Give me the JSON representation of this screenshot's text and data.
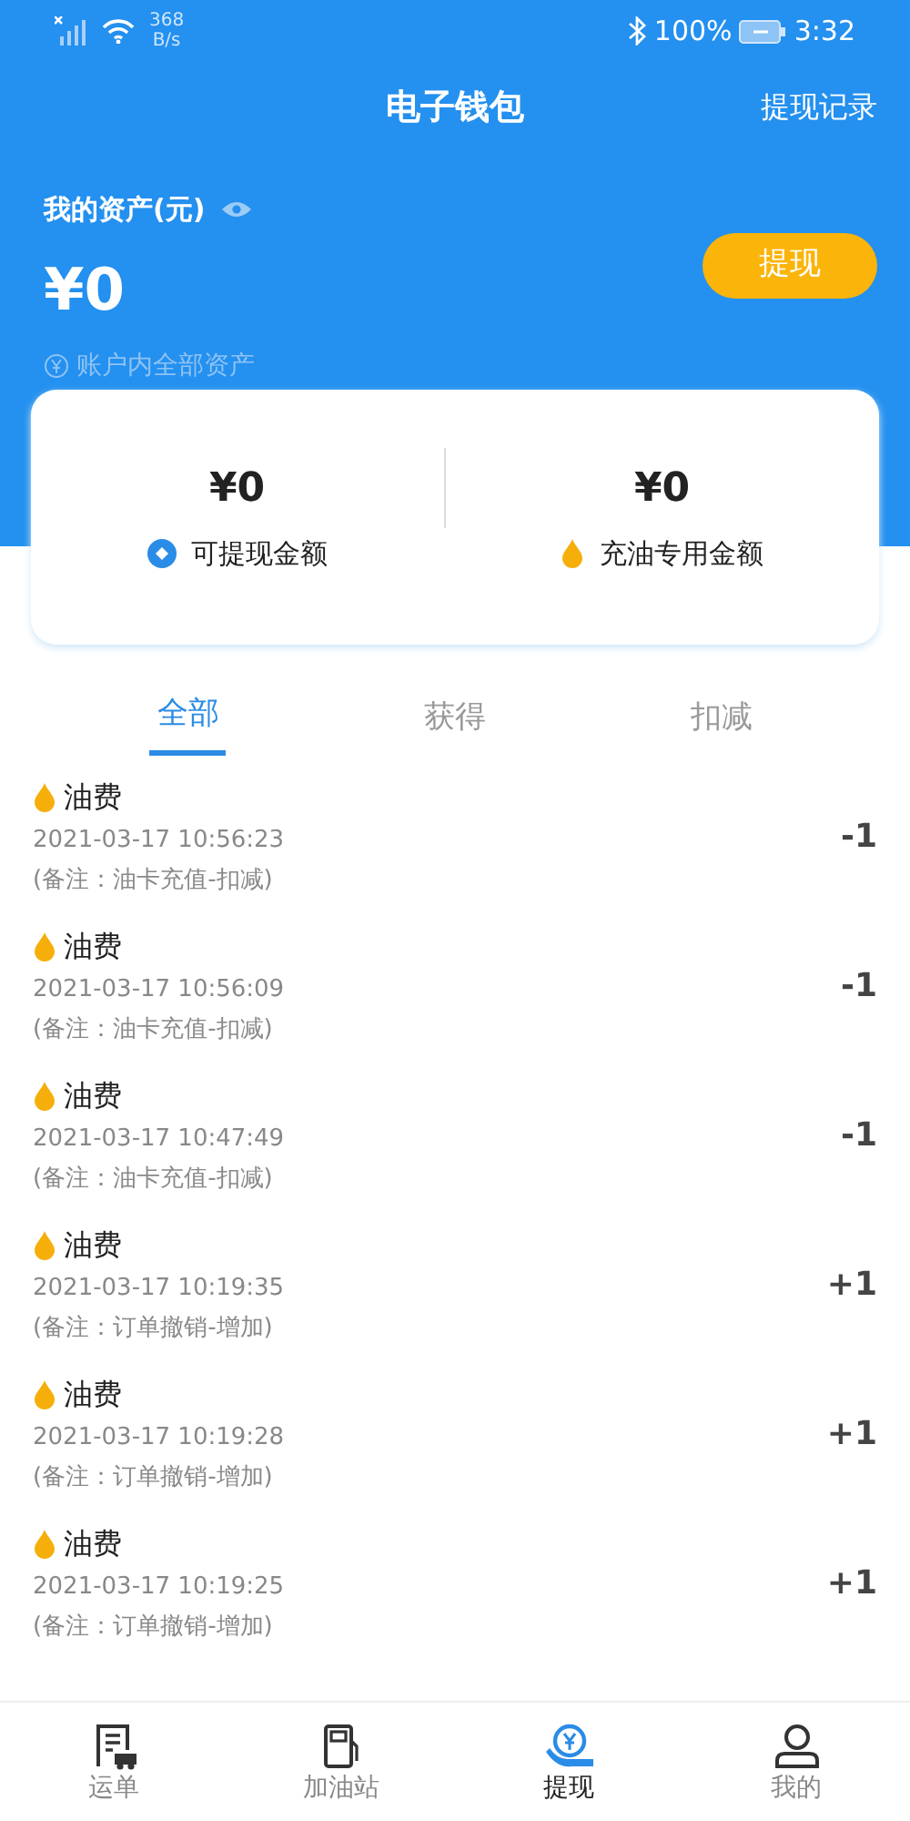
{
  "status_bar": {
    "speed": "368",
    "speed_unit": "B/s",
    "battery": "100%",
    "time": "3:32"
  },
  "header": {
    "title": "电子钱包",
    "action": "提现记录"
  },
  "assets": {
    "label": "我的资产(元)",
    "amount": "¥0",
    "note": "账户内全部资产",
    "button": "提现"
  },
  "balances": [
    {
      "kind": "cash",
      "amount": "¥0",
      "label": "可提现金额"
    },
    {
      "kind": "fuel",
      "amount": "¥0",
      "label": "充油专用金额"
    }
  ],
  "tabs": [
    {
      "label": "全部",
      "selected": true
    },
    {
      "label": "获得",
      "selected": false
    },
    {
      "label": "扣减",
      "selected": false
    }
  ],
  "records": [
    {
      "title": "油费",
      "time": "2021-03-17 10:56:23",
      "remark": "(备注：油卡充值-扣减)",
      "delta": "-1"
    },
    {
      "title": "油费",
      "time": "2021-03-17 10:56:09",
      "remark": "(备注：油卡充值-扣减)",
      "delta": "-1"
    },
    {
      "title": "油费",
      "time": "2021-03-17 10:47:49",
      "remark": "(备注：油卡充值-扣减)",
      "delta": "-1"
    },
    {
      "title": "油费",
      "time": "2021-03-17 10:19:35",
      "remark": "(备注：订单撤销-增加)",
      "delta": "+1"
    },
    {
      "title": "油费",
      "time": "2021-03-17 10:19:28",
      "remark": "(备注：订单撤销-增加)",
      "delta": "+1"
    },
    {
      "title": "油费",
      "time": "2021-03-17 10:19:25",
      "remark": "(备注：订单撤销-增加)",
      "delta": "+1"
    }
  ],
  "nav": [
    {
      "kind": "orders",
      "label": "运单",
      "selected": false
    },
    {
      "kind": "station",
      "label": "加油站",
      "selected": false
    },
    {
      "kind": "withdraw",
      "label": "提现",
      "selected": true
    },
    {
      "kind": "me",
      "label": "我的",
      "selected": false
    }
  ]
}
